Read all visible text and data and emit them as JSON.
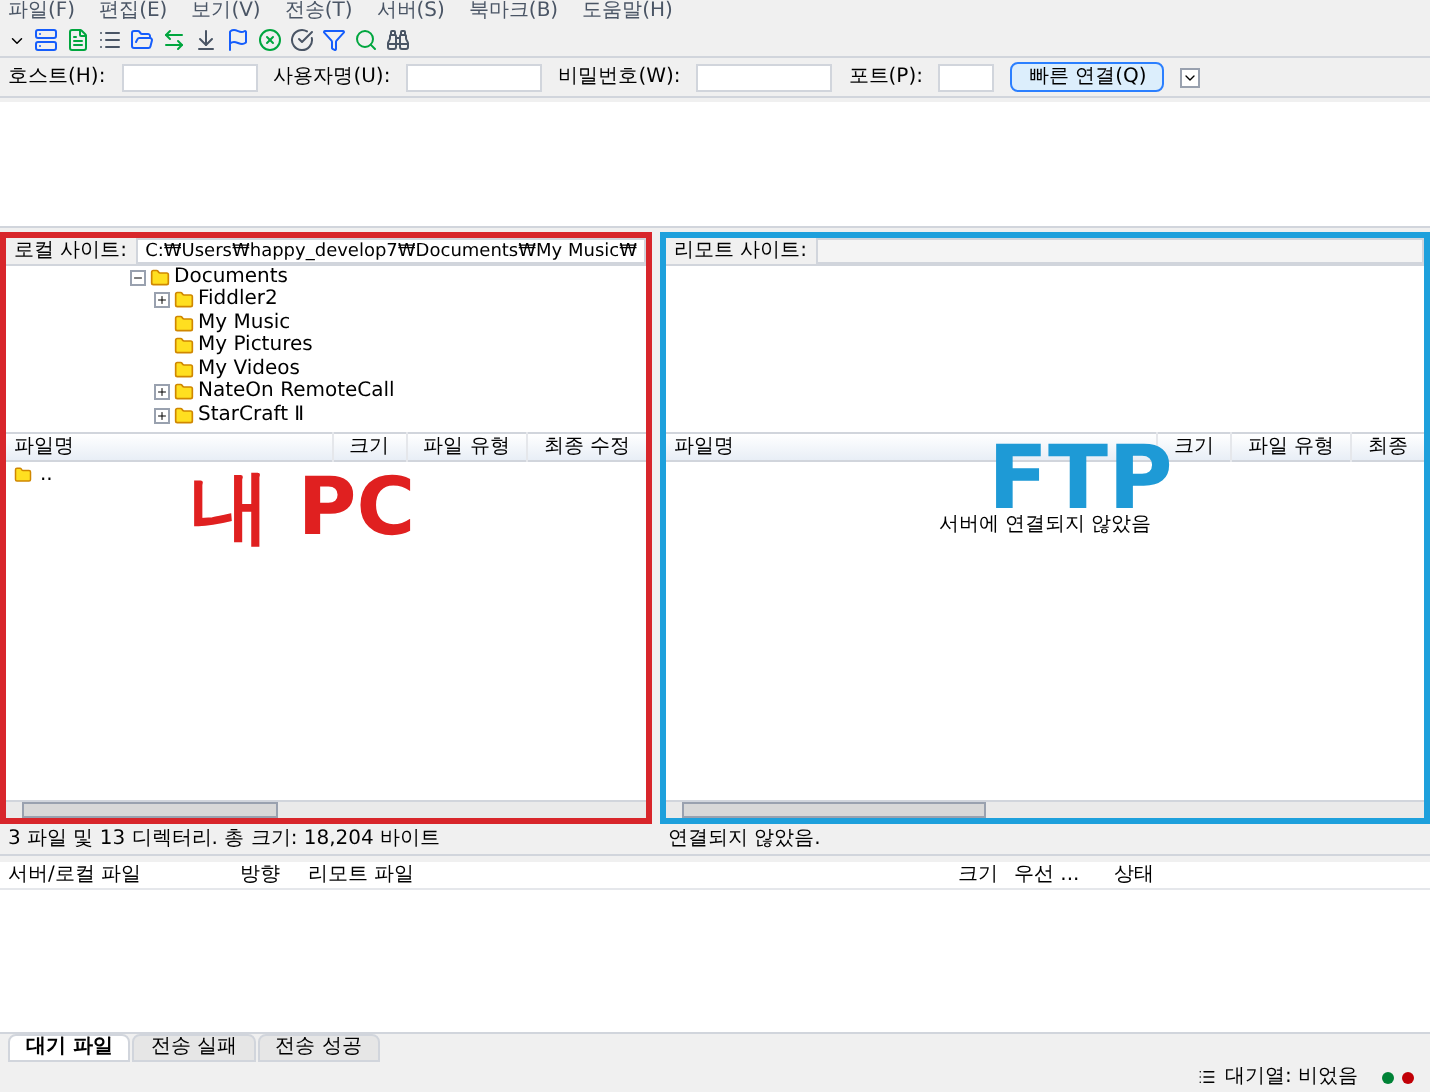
{
  "menu": [
    "파일(F)",
    "편집(E)",
    "보기(V)",
    "전송(T)",
    "서버(S)",
    "북마크(B)",
    "도움말(H)"
  ],
  "quickconnect": {
    "fields": [
      {
        "label": "호스트(H):"
      },
      {
        "label": "사용자명(U):"
      },
      {
        "label": "비밀번호(W):"
      },
      {
        "label": "포트(P):"
      }
    ],
    "button": "빠른 연결(Q)"
  },
  "local": {
    "site_label": "로컬 사이트:",
    "path": "C:₩Users₩happy_develop7₩Documents₩My Music₩",
    "tree": [
      {
        "label": "Documents",
        "expanded": true,
        "children": [
          {
            "label": "Fiddler2",
            "expanded": false
          },
          {
            "label": "My Music"
          },
          {
            "label": "My Pictures"
          },
          {
            "label": "My Videos"
          },
          {
            "label": "NateOn RemoteCall",
            "expanded": false
          },
          {
            "label": "StarCraft Ⅱ",
            "expanded": false
          }
        ]
      }
    ],
    "columns": [
      "파일명",
      "크기",
      "파일 유형",
      "최종 수정"
    ],
    "rows": [
      {
        "name": ".."
      }
    ],
    "status": "3 파일 및 13 디렉터리. 총 크기: 18,204 바이트"
  },
  "remote": {
    "site_label": "리모트 사이트:",
    "columns": [
      "파일명",
      "크기",
      "파일 유형",
      "최종"
    ],
    "message": "서버에 연결되지 않았음",
    "status": "연결되지 않았음."
  },
  "annotations": [
    {
      "text": "내 PC",
      "color": "#e02020"
    },
    {
      "text": "FTP",
      "color": "#1e9ad6"
    }
  ],
  "queue": {
    "columns": [
      "서버/로컬 파일",
      "방향",
      "리모트 파일",
      "크기",
      "우선 ...",
      "상태"
    ]
  },
  "tabs": [
    {
      "label": "대기 파일",
      "selected": true
    },
    {
      "label": "전송 실패",
      "selected": false
    },
    {
      "label": "전송 성공",
      "selected": false
    }
  ],
  "status_bar": {
    "queue": "대기열: 비었음"
  }
}
